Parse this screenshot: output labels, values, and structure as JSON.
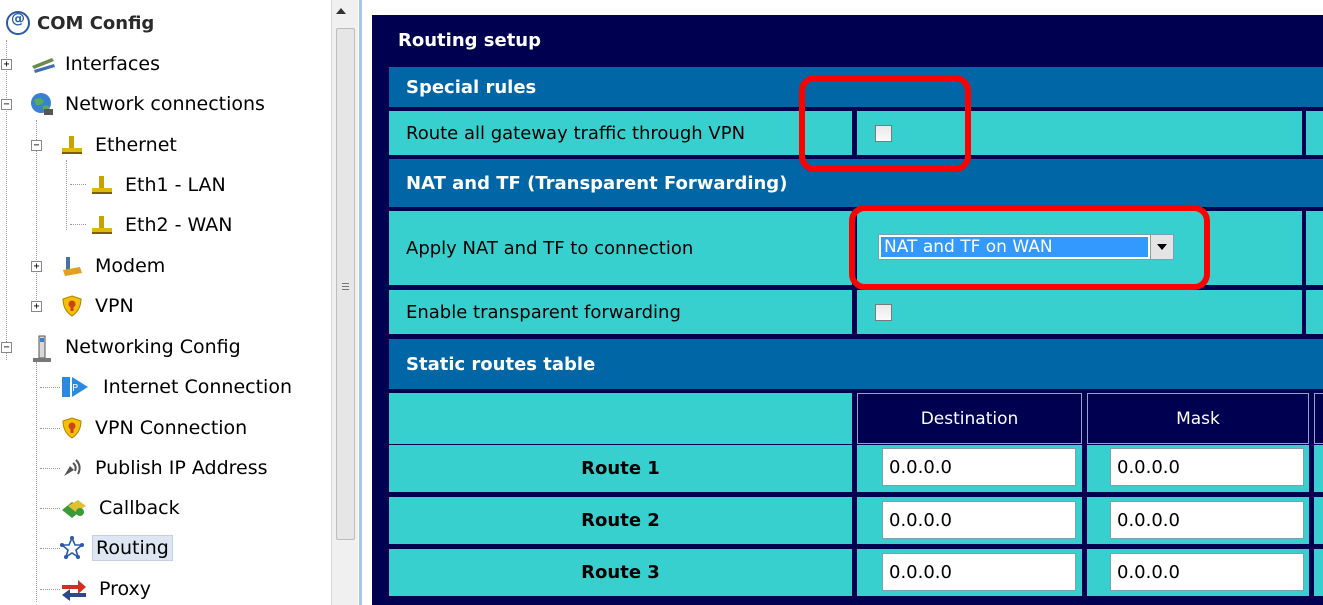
{
  "tree": {
    "root_label": "COM Config",
    "items": [
      {
        "label": "Interfaces"
      },
      {
        "label": "Network connections"
      },
      {
        "label": "Ethernet"
      },
      {
        "label": "Eth1 - LAN"
      },
      {
        "label": "Eth2 - WAN"
      },
      {
        "label": "Modem"
      },
      {
        "label": "VPN"
      },
      {
        "label": "Networking Config"
      },
      {
        "label": "Internet Connection"
      },
      {
        "label": "VPN Connection"
      },
      {
        "label": "Publish IP Address"
      },
      {
        "label": "Callback"
      },
      {
        "label": "Routing",
        "selected": true
      },
      {
        "label": "Proxy"
      }
    ]
  },
  "panel": {
    "title": "Routing setup",
    "special_rules": {
      "header": "Special rules",
      "route_all_label": "Route all gateway traffic through VPN",
      "route_all_checked": false
    },
    "nat_tf": {
      "header": "NAT and TF (Transparent Forwarding)",
      "apply_label": "Apply NAT and TF to connection",
      "apply_value": "NAT and TF on WAN",
      "enable_tf_label": "Enable transparent forwarding",
      "enable_tf_checked": false
    },
    "static_routes": {
      "header": "Static routes table",
      "columns": [
        "Destination",
        "Mask"
      ],
      "rows": [
        {
          "name": "Route 1",
          "destination": "0.0.0.0",
          "mask": "0.0.0.0"
        },
        {
          "name": "Route 2",
          "destination": "0.0.0.0",
          "mask": "0.0.0.0"
        },
        {
          "name": "Route 3",
          "destination": "0.0.0.0",
          "mask": "0.0.0.0"
        }
      ]
    }
  },
  "colors": {
    "panel_bg": "#000050",
    "section_bar": "#0066a6",
    "cell_bg": "#38cfcf",
    "highlight": "#ff0000",
    "selected_option": "#3399ff"
  }
}
